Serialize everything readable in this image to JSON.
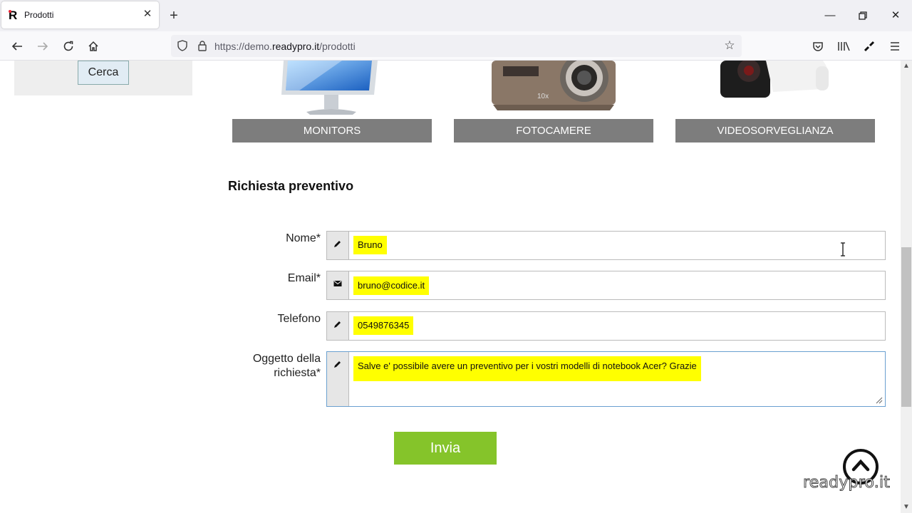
{
  "browser": {
    "tab_title": "Prodotti",
    "url_prefix": "https://demo.",
    "url_domain": "readypro.it",
    "url_path": "/prodotti"
  },
  "sidebar": {
    "search_button": "Cerca"
  },
  "categories": [
    {
      "label": "MONITORS",
      "image_icon": "monitor-image"
    },
    {
      "label": "FOTOCAMERE",
      "image_icon": "camera-image"
    },
    {
      "label": "VIDEOSORVEGLIANZA",
      "image_icon": "security-camera-image"
    }
  ],
  "form": {
    "title": "Richiesta preventivo",
    "fields": {
      "name": {
        "label": "Nome*",
        "value": "Bruno",
        "icon": "pencil-icon"
      },
      "email": {
        "label": "Email*",
        "value": "bruno@codice.it",
        "icon": "envelope-icon"
      },
      "phone": {
        "label": "Telefono",
        "value": "0549876345",
        "icon": "pencil-icon"
      },
      "subject": {
        "label_line1": "Oggetto della",
        "label_line2": "richiesta*",
        "value": "Salve e' possibile avere un preventivo per i vostri modelli di notebook Acer? Grazie",
        "icon": "pencil-icon"
      }
    },
    "submit": "Invia"
  },
  "footer": {
    "logo_text": "readypro.it"
  },
  "colors": {
    "highlight": "#ffff00",
    "submit": "#85c42a",
    "category": "#7d7d7d"
  }
}
